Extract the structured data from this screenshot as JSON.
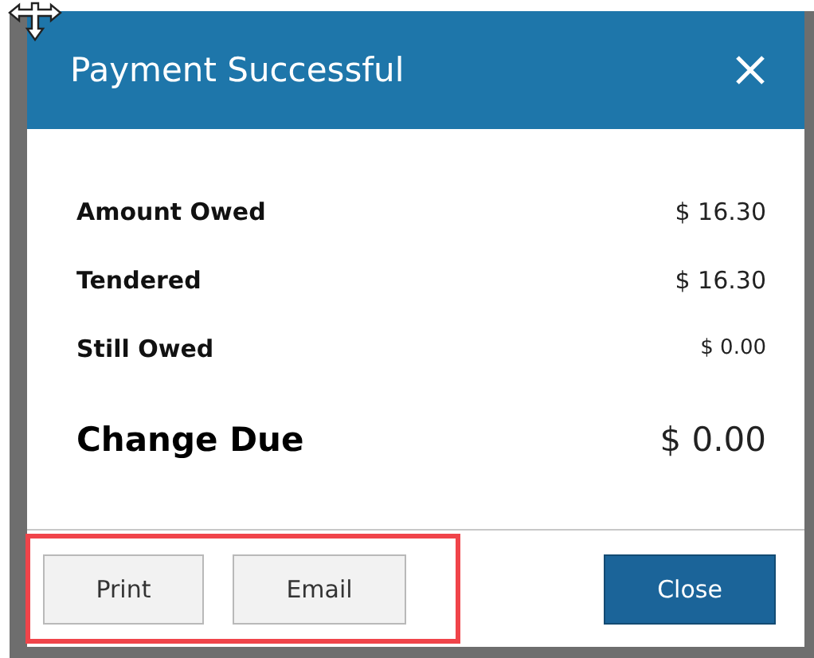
{
  "dialog": {
    "title": "Payment Successful"
  },
  "rows": [
    {
      "label": "Amount Owed",
      "value": "$ 16.30",
      "kind": "normal"
    },
    {
      "label": "Tendered",
      "value": "$ 16.30",
      "kind": "normal"
    },
    {
      "label": "Still Owed",
      "value": "$ 0.00",
      "kind": "small"
    },
    {
      "label": "Change Due",
      "value": "$ 0.00",
      "kind": "total"
    }
  ],
  "footer": {
    "highlight_left": true,
    "left_buttons": [
      {
        "label": "Print"
      },
      {
        "label": "Email"
      }
    ],
    "right_buttons": [
      {
        "label": "Close",
        "kind": "primary"
      }
    ]
  }
}
